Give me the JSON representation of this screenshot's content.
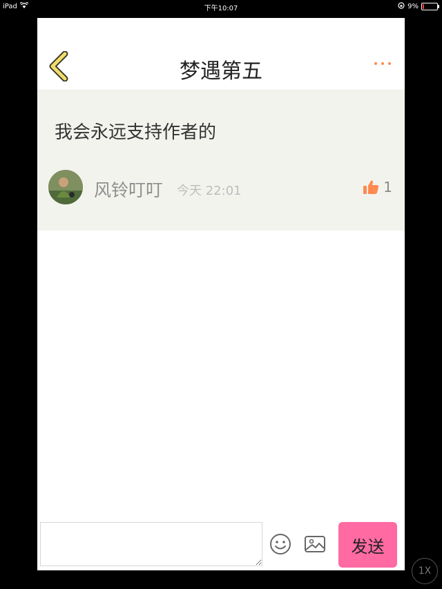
{
  "status_bar": {
    "device": "iPad",
    "time": "下午10:07",
    "battery": "9%",
    "battery_level": 0.09
  },
  "navbar": {
    "title": "梦遇第五"
  },
  "comment": {
    "text": "我会永远支持作者的",
    "username": "风铃叮叮",
    "timestamp": "今天 22:01",
    "likes": "1"
  },
  "composer": {
    "input_value": "",
    "send_label": "发送"
  },
  "zoom_label": "1X",
  "colors": {
    "accent_orange": "#ff8a50",
    "send_button": "#ff6aa3",
    "card_background": "#f3f3ee"
  }
}
